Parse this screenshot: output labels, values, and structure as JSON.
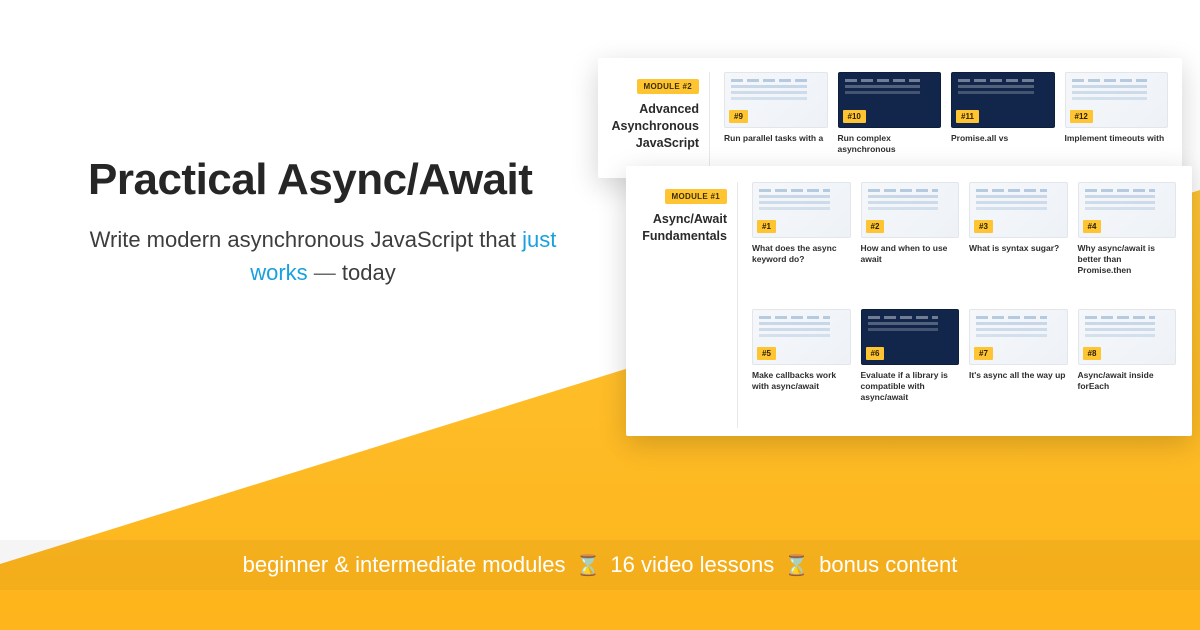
{
  "hero": {
    "title": "Practical Async/Await",
    "sub_pre": "Write modern asynchronous JavaScript that ",
    "sub_accent": "just works",
    "sub_dash": " — ",
    "sub_post": "today"
  },
  "module2": {
    "badge": "MODULE #2",
    "title": "Advanced Asynchronous JavaScript",
    "lessons": [
      {
        "num": "#9",
        "dark": false,
        "title": "Run parallel tasks with a"
      },
      {
        "num": "#10",
        "dark": true,
        "title": "Run complex asynchronous"
      },
      {
        "num": "#11",
        "dark": true,
        "title": "Promise.all vs"
      },
      {
        "num": "#12",
        "dark": false,
        "title": "Implement timeouts with"
      }
    ]
  },
  "module1": {
    "badge": "MODULE #1",
    "title": "Async/Await Fundamentals",
    "lessons": [
      {
        "num": "#1",
        "dark": false,
        "title": "What does the async keyword do?"
      },
      {
        "num": "#2",
        "dark": false,
        "title": "How and when to use await"
      },
      {
        "num": "#3",
        "dark": false,
        "title": "What is syntax sugar?"
      },
      {
        "num": "#4",
        "dark": false,
        "title": "Why async/await is better than Promise.then"
      },
      {
        "num": "#5",
        "dark": false,
        "title": "Make callbacks work with async/await"
      },
      {
        "num": "#6",
        "dark": true,
        "title": "Evaluate if a library is compatible with async/await"
      },
      {
        "num": "#7",
        "dark": false,
        "title": "It's async all the way up"
      },
      {
        "num": "#8",
        "dark": false,
        "title": "Async/await inside forEach"
      }
    ]
  },
  "footer": {
    "seg1": "beginner & intermediate modules",
    "seg2": "16 video lessons",
    "seg3": "bonus content",
    "icon": "⌛"
  }
}
